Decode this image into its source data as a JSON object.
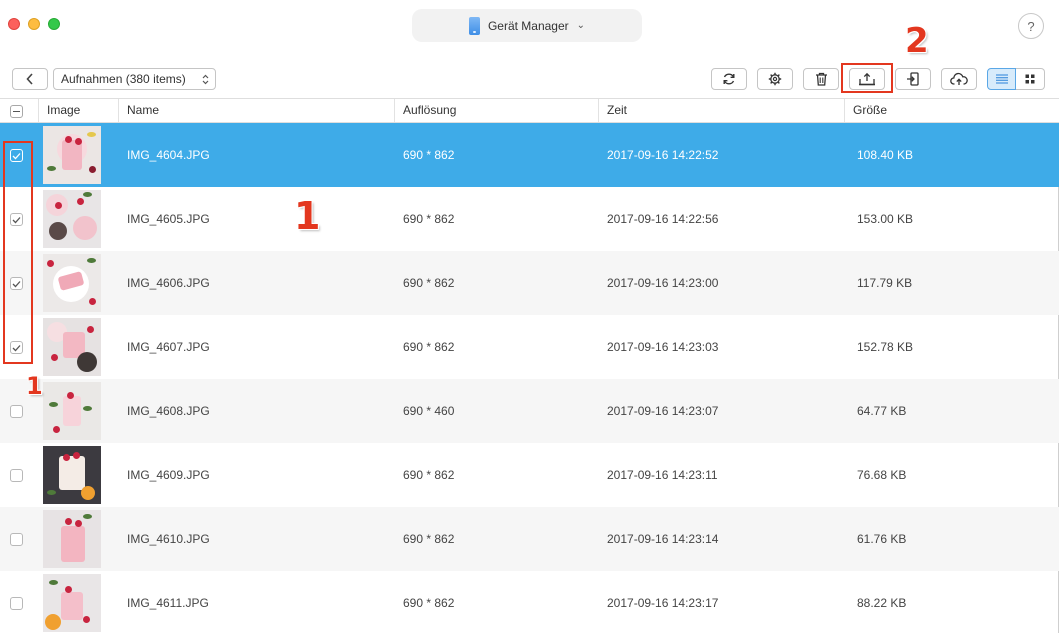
{
  "window": {
    "device_title": "Gerät Manager",
    "help_label": "?"
  },
  "toolbar": {
    "back_label": "‹",
    "album_select_value": "Aufnahmen (380 items)",
    "buttons": {
      "refresh": "refresh-icon",
      "settings": "gear-icon",
      "delete": "trash-icon",
      "export_to_computer": "export-to-computer-icon",
      "send_to_device": "send-to-device-icon",
      "upload_cloud": "cloud-upload-icon",
      "view_list": "list-view-icon",
      "view_grid": "grid-view-icon"
    }
  },
  "table": {
    "columns": {
      "image": "Image",
      "name": "Name",
      "resolution": "Auflösung",
      "time": "Zeit",
      "size": "Größe"
    },
    "rows": [
      {
        "checked": true,
        "selected": true,
        "name": "IMG_4604.JPG",
        "resolution": "690 * 862",
        "time": "2017-09-16 14:22:52",
        "size": "108.40 KB"
      },
      {
        "checked": true,
        "selected": false,
        "name": "IMG_4605.JPG",
        "resolution": "690 * 862",
        "time": "2017-09-16 14:22:56",
        "size": "153.00 KB"
      },
      {
        "checked": true,
        "selected": false,
        "name": "IMG_4606.JPG",
        "resolution": "690 * 862",
        "time": "2017-09-16 14:23:00",
        "size": "117.79 KB"
      },
      {
        "checked": true,
        "selected": false,
        "name": "IMG_4607.JPG",
        "resolution": "690 * 862",
        "time": "2017-09-16 14:23:03",
        "size": "152.78 KB"
      },
      {
        "checked": false,
        "selected": false,
        "name": "IMG_4608.JPG",
        "resolution": "690 * 460",
        "time": "2017-09-16 14:23:07",
        "size": "64.77 KB"
      },
      {
        "checked": false,
        "selected": false,
        "name": "IMG_4609.JPG",
        "resolution": "690 * 862",
        "time": "2017-09-16 14:23:11",
        "size": "76.68 KB"
      },
      {
        "checked": false,
        "selected": false,
        "name": "IMG_4610.JPG",
        "resolution": "690 * 862",
        "time": "2017-09-16 14:23:14",
        "size": "61.76 KB"
      },
      {
        "checked": false,
        "selected": false,
        "name": "IMG_4611.JPG",
        "resolution": "690 * 862",
        "time": "2017-09-16 14:23:17",
        "size": "88.22 KB"
      }
    ]
  },
  "annotations": {
    "step1_label": "1",
    "step1_label_small": "1",
    "step2_label": "2"
  },
  "colors": {
    "selection": "#3eabe8",
    "annotation_red": "#e3371f",
    "active_view": "#d7ebfb"
  }
}
